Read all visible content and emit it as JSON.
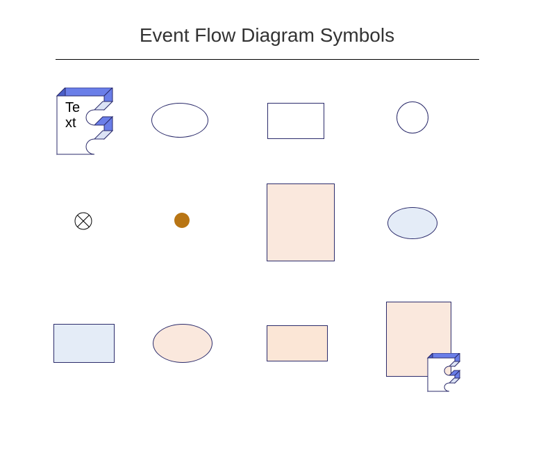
{
  "title": "Event Flow Diagram Symbols",
  "shapes": {
    "e3d_large": {
      "text": "Te\nxt"
    },
    "colors": {
      "navy": "#2a2a6a",
      "blue_3d": "#6a7ee8",
      "blue_dark": "#4a5ec8",
      "light_blue_fill": "#e4ecf7",
      "light_peach_fill": "#fae8dd",
      "peach_fill": "#fbe6d6",
      "brown_dot": "#b87514"
    }
  }
}
